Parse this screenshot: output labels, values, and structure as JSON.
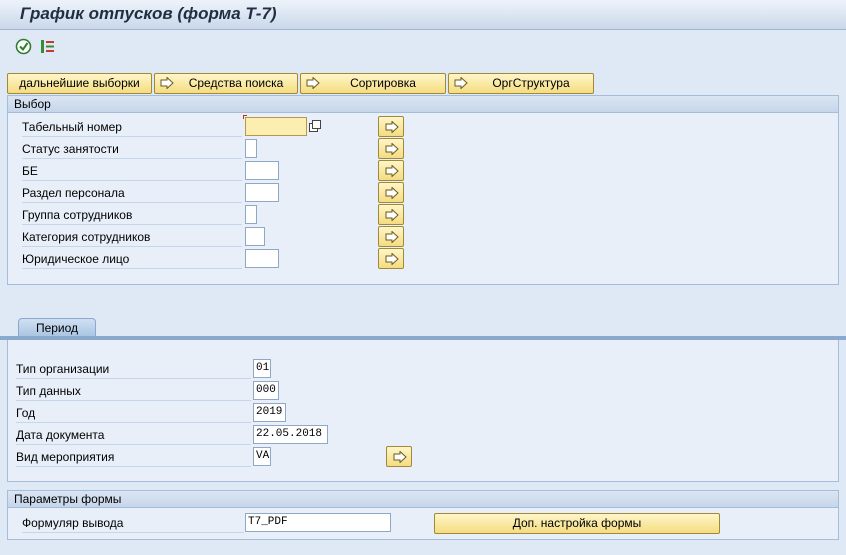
{
  "title": "График отпусков (форма Т-7)",
  "toolbar": {
    "execute_icon": "execute-icon",
    "variant_icon": "variant-icon"
  },
  "buttons": {
    "more_selections": "дальнейшие выборки",
    "search_help": "Средства поиска",
    "sort": "Сортировка",
    "org_structure": "ОргСтруктура"
  },
  "selection": {
    "header": "Выбор",
    "fields": [
      {
        "label": "Табельный номер",
        "value": ""
      },
      {
        "label": "Статус занятости",
        "value": ""
      },
      {
        "label": "БЕ",
        "value": ""
      },
      {
        "label": "Раздел персонала",
        "value": ""
      },
      {
        "label": "Группа сотрудников",
        "value": ""
      },
      {
        "label": "Категория сотрудников",
        "value": ""
      },
      {
        "label": "Юридическое лицо",
        "value": ""
      }
    ]
  },
  "period": {
    "tab": "Период",
    "fields": [
      {
        "label": "Тип организации",
        "value": "01"
      },
      {
        "label": "Тип данных",
        "value": "000"
      },
      {
        "label": "Год",
        "value": "2019"
      },
      {
        "label": "Дата документа",
        "value": "22.05.2018"
      },
      {
        "label": "Вид мероприятия",
        "value": "VA"
      }
    ]
  },
  "form_params": {
    "header": "Параметры формы",
    "output_label": "Формуляр вывода",
    "output_value": "T7_PDF",
    "extra_button": "Доп. настройка формы"
  },
  "colors": {
    "accent": "#f4dc80",
    "panel": "#e8eff8",
    "background": "#dfe9f5"
  }
}
